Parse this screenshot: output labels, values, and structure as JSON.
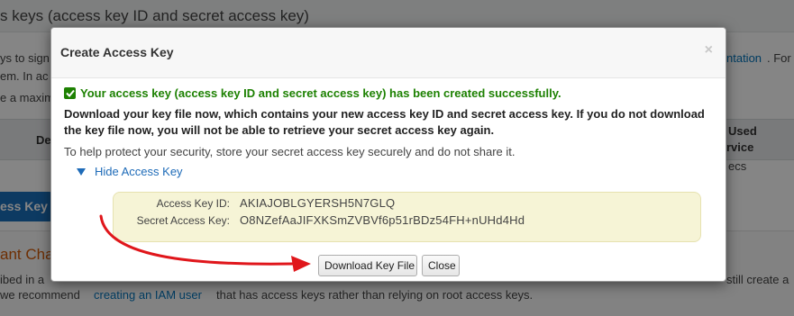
{
  "background": {
    "header_title": "s keys (access key ID and secret access key)",
    "line1_left": "ys to sign",
    "line1_link": "ntation",
    "line1_right": ". For",
    "line2_left": "em. In ac",
    "line3_left": "e a maxim",
    "th_left": "De",
    "th_right_1": "Used",
    "th_right_2": "rvice",
    "row_right": "ecs",
    "blue_button": "ess Key",
    "orange_heading": "ant Cha",
    "bottom_line1_left": "ibed in a",
    "bottom_line1_right": "still create a",
    "bottom_line2_prefix": " we recommend",
    "bottom_line2_link": "creating an IAM user",
    "bottom_line2_suffix": "that has access keys rather than relying on root access keys."
  },
  "dialog": {
    "title": "Create Access Key",
    "close_symbol": "×",
    "success_message": "Your access key (access key ID and secret access key) has been created successfully.",
    "warning_message": "Download your key file now, which contains your new access key ID and secret access key. If you do not download the key file now, you will not be able to retrieve your secret access key again.",
    "protect_message": "To help protect your security, store your secret access key securely and do not share it.",
    "toggle_label": "Hide Access Key",
    "access_key_id_label": "Access Key ID:",
    "access_key_id_value": "AKIAJOBLGYERSH5N7GLQ",
    "secret_key_label": "Secret Access Key:",
    "secret_key_value": "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",
    "download_button": "Download Key File",
    "close_button": "Close"
  },
  "colors": {
    "success": "#1d8102",
    "link": "#1e6bb8",
    "annotation_arrow": "#e0161b",
    "key_box_bg": "#f6f4d6"
  }
}
